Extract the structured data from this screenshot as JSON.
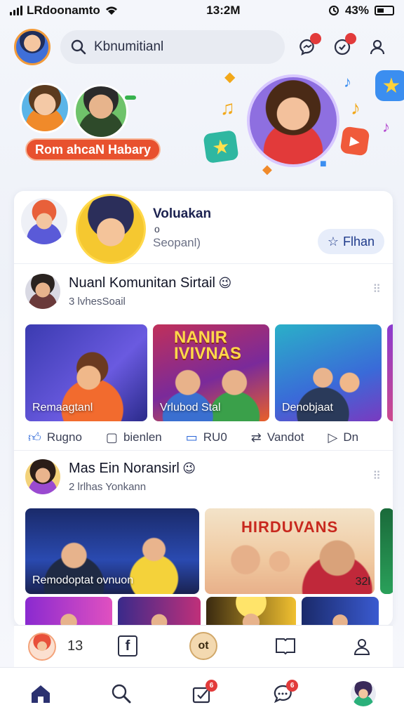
{
  "status_bar": {
    "carrier": "LRdoonamto",
    "time": "13:2M",
    "battery": "43%"
  },
  "header": {
    "search_text": "Kbnumitianl",
    "badge1": "",
    "badge2": ""
  },
  "hero": {
    "friend_tag": "",
    "banner": "Rom ahcaN Habary"
  },
  "profile": {
    "name": "Voluakan",
    "count": "o",
    "subtitle": "Seopanl)",
    "follow_label": "Flhan"
  },
  "posts": [
    {
      "title": "Nuanl Komunitan Sirtail",
      "meta": "3 lvhesSoail",
      "more": "⠿",
      "thumbs": [
        "Remaagtanl",
        "Vrlubod Stal",
        "Denobjaat"
      ],
      "thumb2_title": "NANIR\nIVIVNAS",
      "actions": [
        "Rugno",
        "bienlen",
        "RU0",
        "Vandot",
        "Dn"
      ]
    },
    {
      "title": "Mas Ein Noransirl",
      "meta": "2 lrlhas Yonkann",
      "more": "⠿",
      "videos": [
        "Remodoptat ovnuon",
        ""
      ],
      "video2_title": "HIRDUVANS",
      "video2_num": "32l"
    }
  ],
  "sub_bar": {
    "count": "13",
    "center_label": "ot"
  },
  "bottom_nav": {
    "badge1": "6",
    "badge2": "6"
  },
  "icons": [
    "search-icon",
    "messenger-icon",
    "notification-icon",
    "profile-icon",
    "home-icon",
    "explore-icon",
    "inbox-icon",
    "chat-icon",
    "like-icon",
    "comment-icon",
    "share-icon",
    "repost-icon"
  ],
  "colors": {
    "accent": "#2a66d8",
    "badge": "#e23b3b",
    "banner": "#e8512e",
    "nav_active": "#2b3170"
  }
}
